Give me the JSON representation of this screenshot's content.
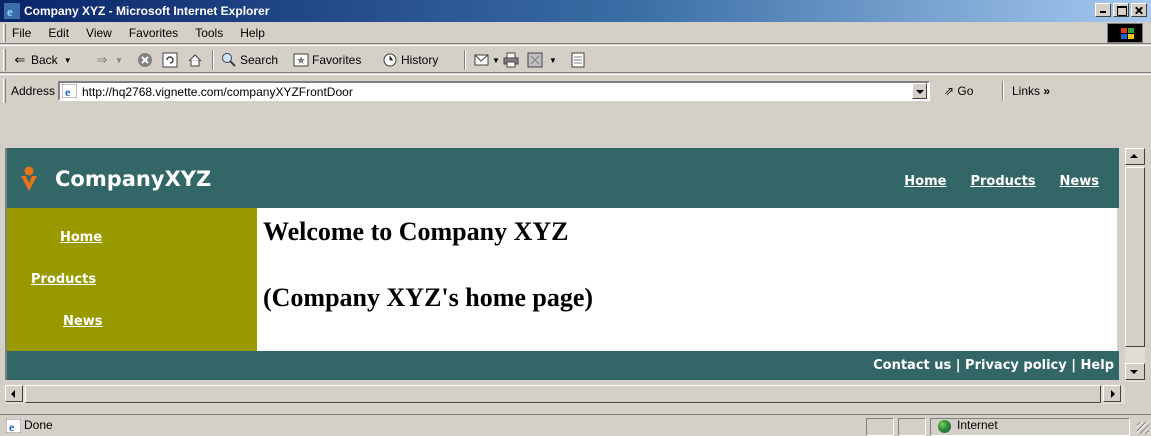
{
  "window": {
    "title": "Company XYZ - Microsoft Internet Explorer"
  },
  "menu": {
    "items": [
      "File",
      "Edit",
      "View",
      "Favorites",
      "Tools",
      "Help"
    ]
  },
  "toolbar": {
    "back_label": "Back",
    "search_label": "Search",
    "favorites_label": "Favorites",
    "history_label": "History"
  },
  "address": {
    "label": "Address",
    "url": "http://hq2768.vignette.com/companyXYZFrontDoor",
    "go_label": "Go",
    "links_label": "Links"
  },
  "site": {
    "logo_text": "CompanyXYZ",
    "top_nav": [
      "Home",
      "Products",
      "News"
    ],
    "side_nav": [
      "Home",
      "Products",
      "News"
    ],
    "heading1": "Welcome to Company XYZ",
    "heading2": "(Company XYZ's home page)",
    "footer": "Contact us | Privacy policy | Help",
    "colors": {
      "header": "#336666",
      "sidebar": "#999900",
      "logo_mark": "#e8741a"
    }
  },
  "status": {
    "text": "Done",
    "zone": "Internet"
  }
}
